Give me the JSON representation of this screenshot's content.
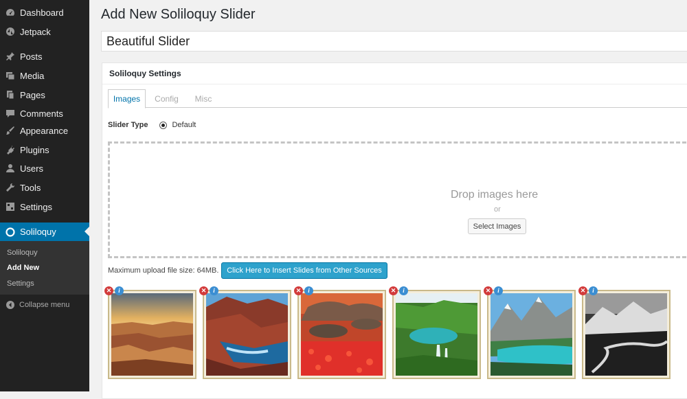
{
  "sidebar": {
    "items": [
      {
        "label": "Dashboard",
        "icon": "dashboard-icon"
      },
      {
        "label": "Jetpack",
        "icon": "jetpack-icon"
      },
      {
        "label": "Posts",
        "icon": "pin-icon"
      },
      {
        "label": "Media",
        "icon": "media-icon"
      },
      {
        "label": "Pages",
        "icon": "pages-icon"
      },
      {
        "label": "Comments",
        "icon": "comment-icon"
      },
      {
        "label": "Appearance",
        "icon": "brush-icon"
      },
      {
        "label": "Plugins",
        "icon": "plug-icon"
      },
      {
        "label": "Users",
        "icon": "user-icon"
      },
      {
        "label": "Tools",
        "icon": "wrench-icon"
      },
      {
        "label": "Settings",
        "icon": "settings-icon"
      },
      {
        "label": "Soliloquy",
        "icon": "soliloquy-icon"
      }
    ],
    "submenu": [
      "Soliloquy",
      "Add New",
      "Settings"
    ],
    "collapse_label": "Collapse menu"
  },
  "page": {
    "title": "Add New Soliloquy Slider",
    "slider_name": "Beautiful Slider"
  },
  "settings_box": {
    "title": "Soliloquy Settings",
    "tabs": [
      "Images",
      "Config",
      "Misc"
    ],
    "slider_type_label": "Slider Type",
    "slider_type_value": "Default",
    "drop_text": "Drop images here",
    "drop_or": "or",
    "select_button": "Select Images",
    "upload_note": "Maximum upload file size: 64MB.",
    "insert_button": "Click Here to Insert Slides from Other Sources"
  },
  "thumbnails": [
    {
      "subject": "canyon-sunset"
    },
    {
      "subject": "red-rock-river"
    },
    {
      "subject": "red-flower-field"
    },
    {
      "subject": "green-lake-waterfalls"
    },
    {
      "subject": "mountain-turquoise-lake"
    },
    {
      "subject": "black-white-river-valley"
    }
  ],
  "colors": {
    "accent": "#0073aa",
    "insert_button": "#2ea2cc",
    "delete": "#d23b3b",
    "info": "#3b8ed2"
  }
}
